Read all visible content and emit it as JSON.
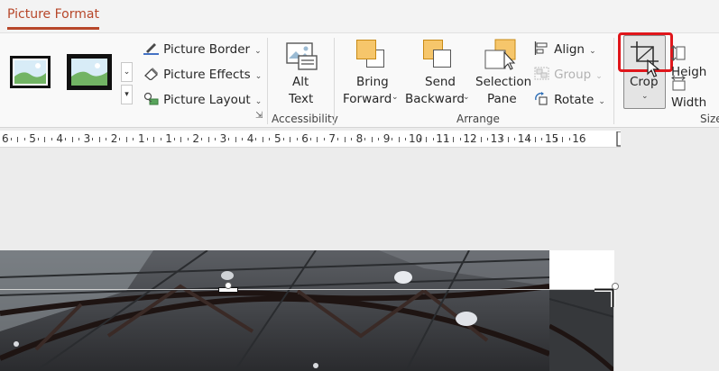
{
  "tab": {
    "label": "Picture Format",
    "accent": "#b7472a"
  },
  "picture_styles": {
    "thumbnails": [
      "picture-style-simple-frame-black",
      "picture-style-thick-black-frame"
    ],
    "scroll": [
      "chevron-down-icon",
      "more-icon"
    ]
  },
  "picture_options": {
    "border": "Picture Border",
    "effects": "Picture Effects",
    "layout": "Picture Layout"
  },
  "accessibility": {
    "alt_text_line1": "Alt",
    "alt_text_line2": "Text",
    "group_label": "Accessibility"
  },
  "arrange": {
    "bring_forward_line1": "Bring",
    "bring_forward_line2": "Forward",
    "send_backward_line1": "Send",
    "send_backward_line2": "Backward",
    "selection_pane_line1": "Selection",
    "selection_pane_line2": "Pane",
    "align": "Align",
    "group": "Group",
    "rotate": "Rotate",
    "group_label": "Arrange"
  },
  "size": {
    "crop": "Crop",
    "height": "Heigh",
    "width": "Width",
    "group_label": "Size"
  },
  "ruler": {
    "numbers": [
      "6",
      "5",
      "4",
      "3",
      "2",
      "1",
      "1",
      "2",
      "3",
      "4",
      "5",
      "6",
      "7",
      "8",
      "9",
      "10",
      "11",
      "12",
      "13",
      "14",
      "15",
      "16"
    ]
  },
  "highlight_color": "#e0161b"
}
